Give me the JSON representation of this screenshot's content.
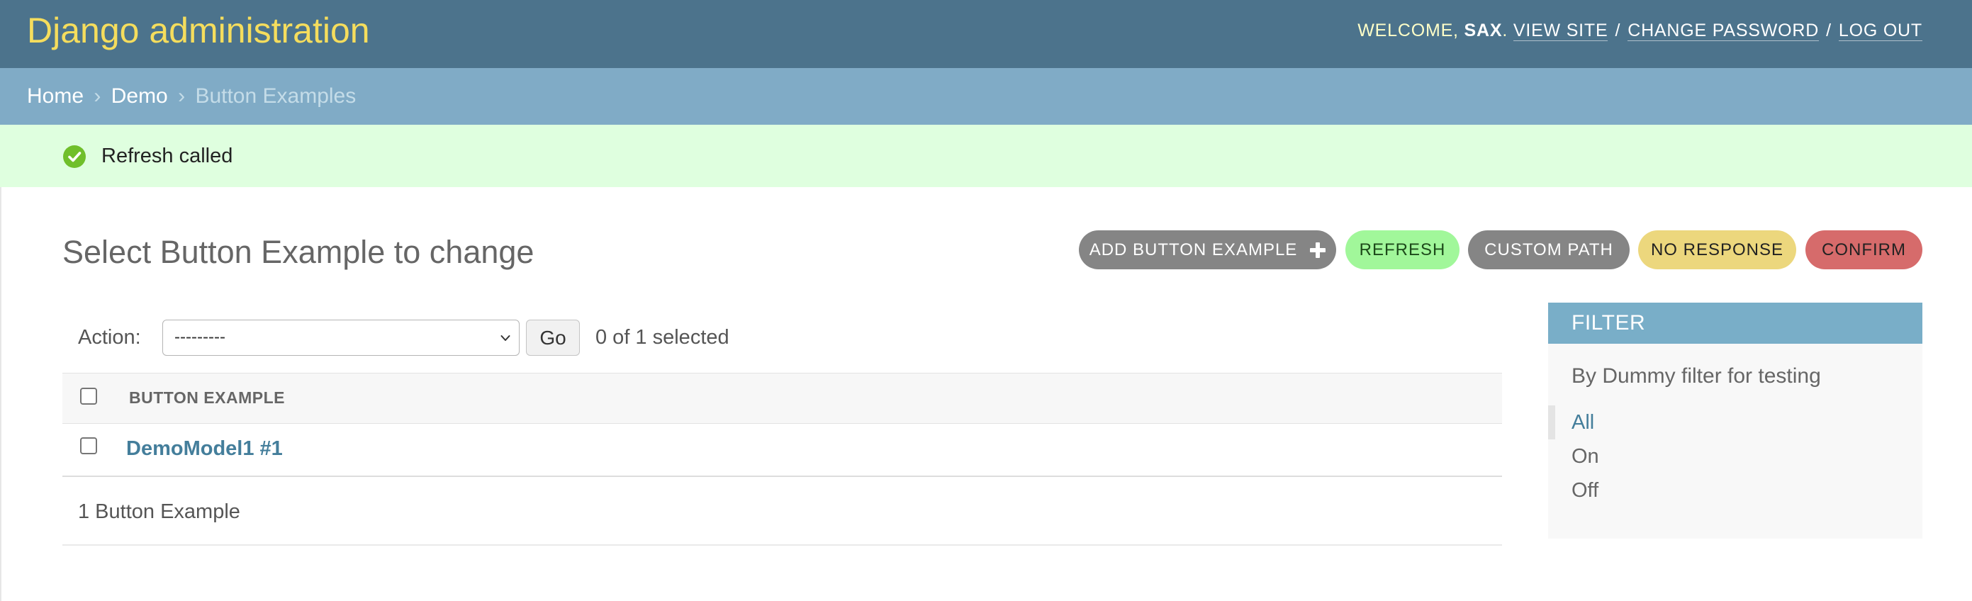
{
  "header": {
    "brand": "Django administration",
    "welcome_prefix": "Welcome,",
    "username": "sax",
    "after_username": ".",
    "links": {
      "view_site": "View site",
      "change_password": "Change password",
      "log_out": "Log out"
    },
    "separator": "/"
  },
  "breadcrumbs": {
    "home": "Home",
    "app": "Demo",
    "current": "Button Examples",
    "separator": "›"
  },
  "message": {
    "icon": "success-check-icon",
    "text": "Refresh called"
  },
  "page": {
    "title": "Select Button Example to change"
  },
  "object_tools": {
    "add": "Add Button Example",
    "refresh": "Refresh",
    "custom_path": "Custom Path",
    "no_response": "No Response",
    "confirm": "Confirm"
  },
  "actions": {
    "label": "Action:",
    "selected_option": "---------",
    "go_label": "Go",
    "selection_counter": "0 of 1 selected"
  },
  "results": {
    "column_header": "Button Example",
    "rows": [
      {
        "label": "DemoModel1 #1",
        "checked": false
      }
    ],
    "paginator": "1 Button Example"
  },
  "filter": {
    "title": "Filter",
    "subtitle": "By Dummy filter for testing",
    "options": [
      {
        "label": "All",
        "selected": true
      },
      {
        "label": "On",
        "selected": false
      },
      {
        "label": "Off",
        "selected": false
      }
    ]
  },
  "colors": {
    "header_bg": "#4c738c",
    "brand": "#f5dd5d",
    "breadcrumbs_bg": "#80abc6",
    "message_bg": "#dfffdf",
    "success_icon": "#70bf2b",
    "link": "#447e9b",
    "filter_head_bg": "#79aec8",
    "refresh_btn": "#a1f79a",
    "no_response_btn": "#ecd77d",
    "confirm_btn": "#d66b6b",
    "neutral_btn": "#858585"
  }
}
